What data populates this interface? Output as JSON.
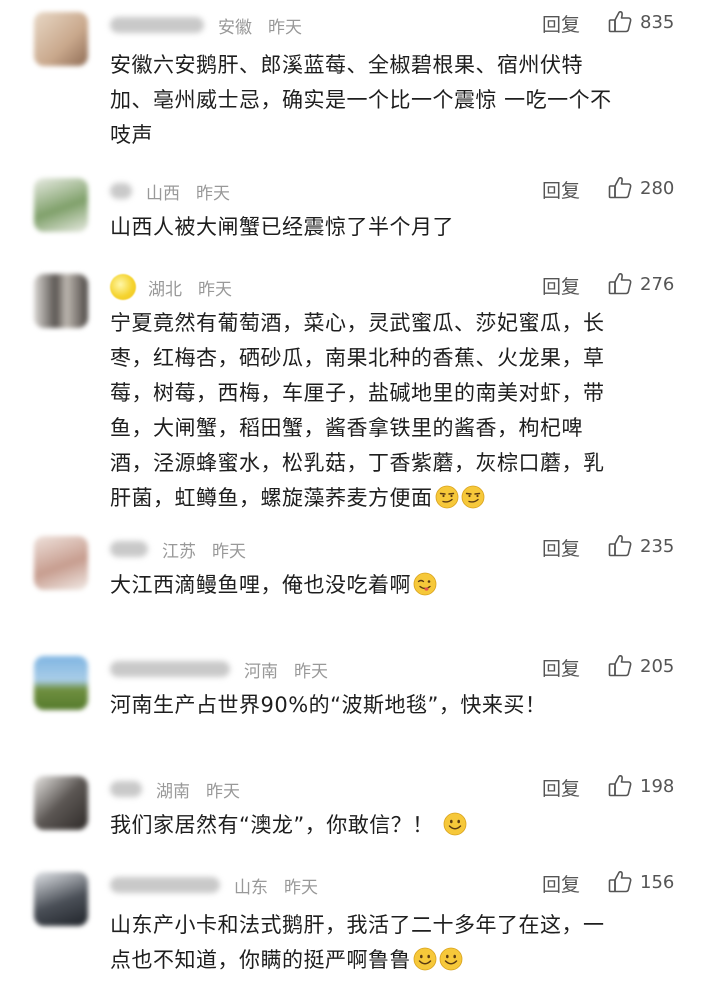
{
  "comments": [
    {
      "region": "安徽",
      "time": "昨天",
      "reply": "回复",
      "likes": "835",
      "lines": [
        "安徽六安鹅肝、郎溪蓝莓、全椒碧根果、宿州伏特",
        "加、亳州威士忌，确实是一个比一个震惊 一吃一个不",
        "吱声"
      ]
    },
    {
      "region": "山西",
      "time": "昨天",
      "reply": "回复",
      "likes": "280",
      "lines": [
        "山西人被大闸蟹已经震惊了半个月了"
      ]
    },
    {
      "region": "湖北",
      "time": "昨天",
      "reply": "回复",
      "likes": "276",
      "lines": [
        "宁夏竟然有葡萄酒，菜心，灵武蜜瓜、莎妃蜜瓜，长",
        "枣，红梅杏，硒砂瓜，南果北种的香蕉、火龙果，草",
        "莓，树莓，西梅，车厘子，盐碱地里的南美对虾，带",
        "鱼，大闸蟹，稻田蟹，酱香拿铁里的酱香，枸杞啤",
        "酒，泾源蜂蜜水，松乳菇，丁香紫蘑，灰棕口蘑，乳",
        "肝菌，虹鳟鱼，螺旋藻荞麦方便面"
      ]
    },
    {
      "region": "江苏",
      "time": "昨天",
      "reply": "回复",
      "likes": "235",
      "lines": [
        "大江西滴鳗鱼哩，俺也没吃着啊"
      ]
    },
    {
      "region": "河南",
      "time": "昨天",
      "reply": "回复",
      "likes": "205",
      "lines": [
        "河南生产占世界90%的“波斯地毯”，快来买！"
      ]
    },
    {
      "region": "湖南",
      "time": "昨天",
      "reply": "回复",
      "likes": "198",
      "lines": [
        "我们家居然有“澳龙”，你敢信？！"
      ]
    },
    {
      "region": "山东",
      "time": "昨天",
      "reply": "回复",
      "likes": "156",
      "lines": [
        "山东产小卡和法式鹅肝，我活了二十多年了在这，一",
        "点也不知道，你瞒的挺严啊鲁鲁"
      ]
    }
  ],
  "icons": {
    "like": "thumbs-up-outline-icon",
    "emoji_smirk": "smirk-emoji-icon",
    "emoji_wink": "tongue-wink-emoji-icon",
    "emoji_smile": "smile-emoji-icon"
  }
}
